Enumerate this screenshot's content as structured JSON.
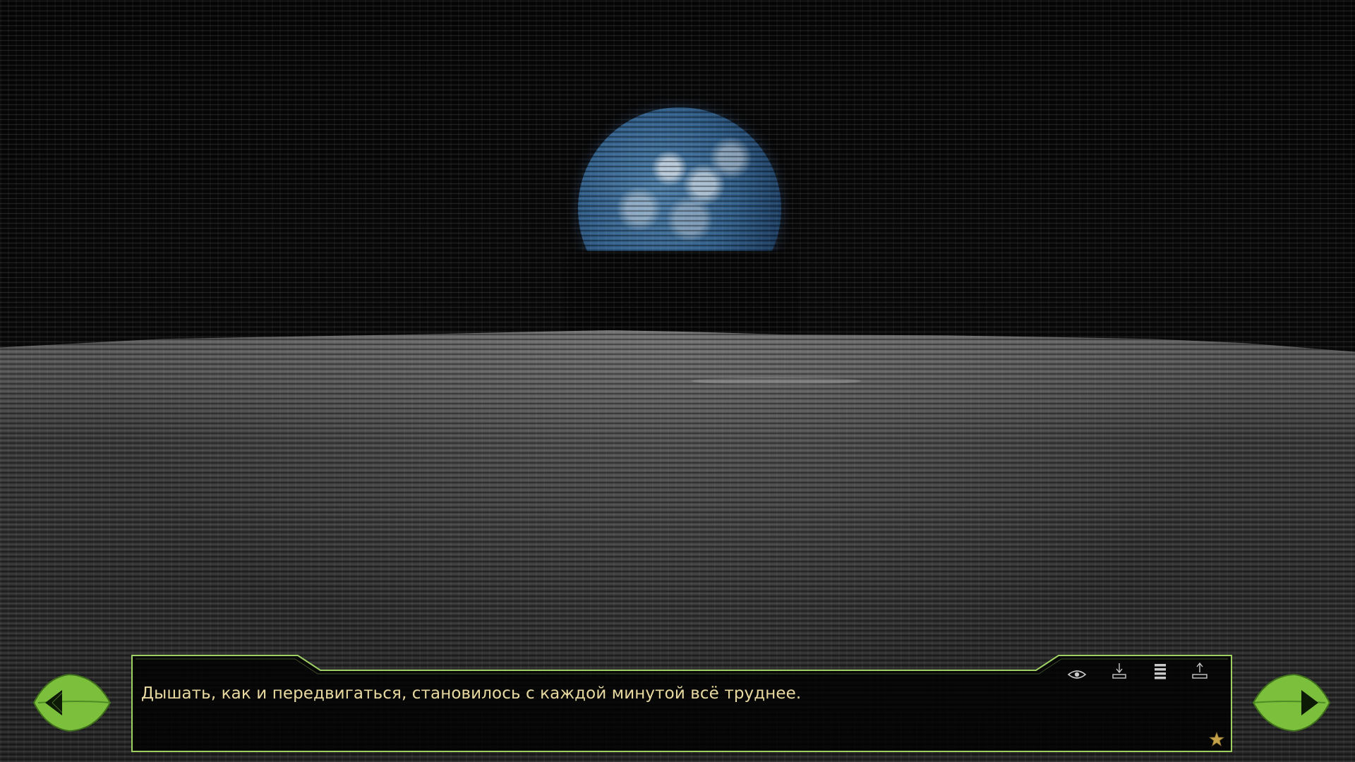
{
  "dialogue": {
    "text": "Дышать, как и передвигаться, становилось с каждой минутой всё труднее."
  },
  "quick_menu": {
    "items": [
      {
        "icon": "eye-icon"
      },
      {
        "icon": "save-icon"
      },
      {
        "icon": "menu-list-icon"
      },
      {
        "icon": "load-icon"
      }
    ]
  },
  "navigation": {
    "prev_icon": "leaf-arrow-left-icon",
    "next_icon": "leaf-arrow-right-icon"
  },
  "colors": {
    "frame_border": "#9fd064",
    "text": "#e8d9a0",
    "leaf": "#7cbf3c",
    "icon": "#c9c9c9",
    "star": "#c5a24a"
  }
}
